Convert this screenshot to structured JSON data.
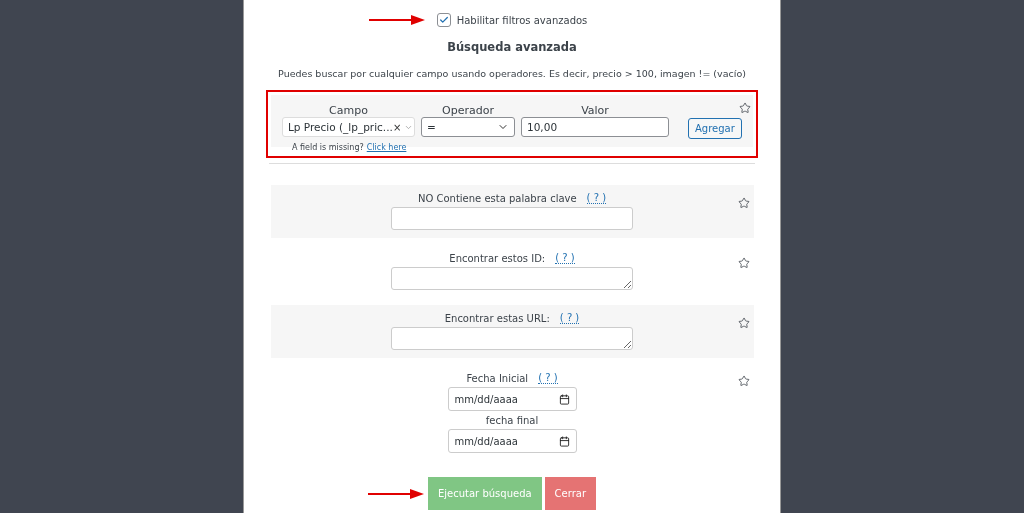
{
  "advanced_filters": {
    "label": "Habilitar filtros avanzados",
    "checked": true
  },
  "title": "Búsqueda avanzada",
  "description": "Puedes buscar por cualquier campo usando operadores. Es decir, precio > 100, imagen != (vacío)",
  "operator_row": {
    "columns": [
      {
        "kind": "field",
        "label": "Campo",
        "value": "Lp Precio (_lp_pric...",
        "clear": "×"
      },
      {
        "kind": "operator",
        "label": "Operador",
        "value": "="
      },
      {
        "kind": "value",
        "label": "Valor",
        "value": "10,00"
      }
    ],
    "add_button": "Agregar",
    "missing_note": "A field is missing?",
    "missing_link": "Click here"
  },
  "filters": [
    {
      "kind": "text",
      "label": "NO Contiene esta palabra clave",
      "help": "( ? )"
    },
    {
      "kind": "textarea",
      "label": "Encontrar estos ID:",
      "help": "( ? )"
    },
    {
      "kind": "textarea",
      "label": "Encontrar estas URL:",
      "help": "( ? )"
    },
    {
      "kind": "dates",
      "label": "Fecha Inicial",
      "help": "( ? )",
      "placeholder": "mm/dd/aaaa",
      "second_label": "fecha final",
      "second_placeholder": "mm/dd/aaaa"
    }
  ],
  "actions": [
    {
      "kind": "primary",
      "label": "Ejecutar búsqueda"
    },
    {
      "kind": "danger",
      "label": "Cerrar"
    }
  ]
}
